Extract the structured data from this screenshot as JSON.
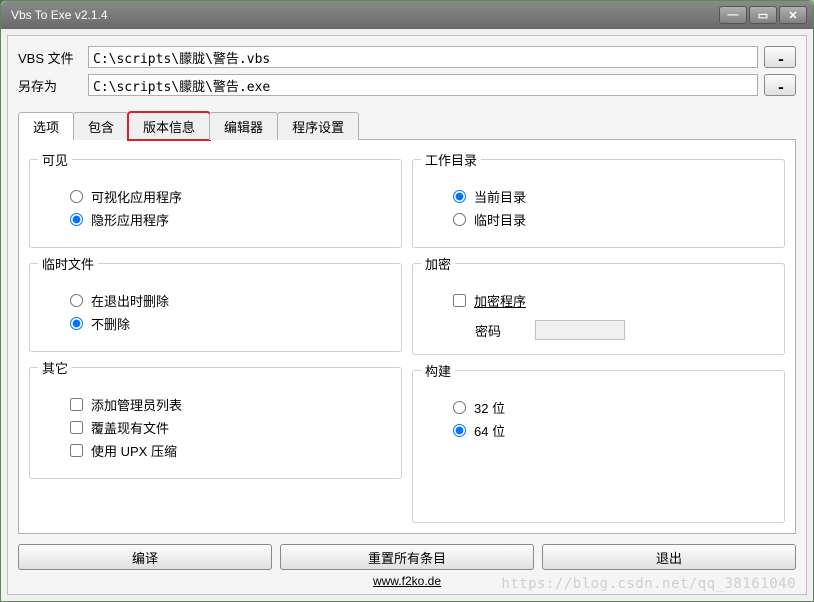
{
  "window": {
    "title": "Vbs To Exe v2.1.4"
  },
  "files": {
    "vbs_label": "VBS 文件",
    "vbs_path": "C:\\scripts\\朦胧\\警告.vbs",
    "saveas_label": "另存为",
    "saveas_path": "C:\\scripts\\朦胧\\警告.exe",
    "browse_ellipsis": "..."
  },
  "tabs": {
    "options": "选项",
    "include": "包含",
    "version": "版本信息",
    "editor": "编辑器",
    "settings": "程序设置"
  },
  "groups": {
    "visibility": {
      "legend": "可见",
      "visible_app": "可视化应用程序",
      "invisible_app": "隐形应用程序"
    },
    "tempfiles": {
      "legend": "临时文件",
      "delete_on_exit": "在退出时删除",
      "no_delete": "不删除"
    },
    "other": {
      "legend": "其它",
      "admin_manifest": "添加管理员列表",
      "overwrite": "覆盖现有文件",
      "upx": "使用 UPX 压缩"
    },
    "workingdir": {
      "legend": "工作目录",
      "current": "当前目录",
      "temp": "临时目录"
    },
    "encrypt": {
      "legend": "加密",
      "encrypt_program": "加密程序",
      "password_label": "密码"
    },
    "build": {
      "legend": "构建",
      "bit32": "32 位",
      "bit64": "64 位"
    }
  },
  "buttons": {
    "compile": "编译",
    "reset": "重置所有条目",
    "exit": "退出"
  },
  "footer": {
    "url": "www.f2ko.de"
  },
  "watermark": "https://blog.csdn.net/qq_38161040"
}
